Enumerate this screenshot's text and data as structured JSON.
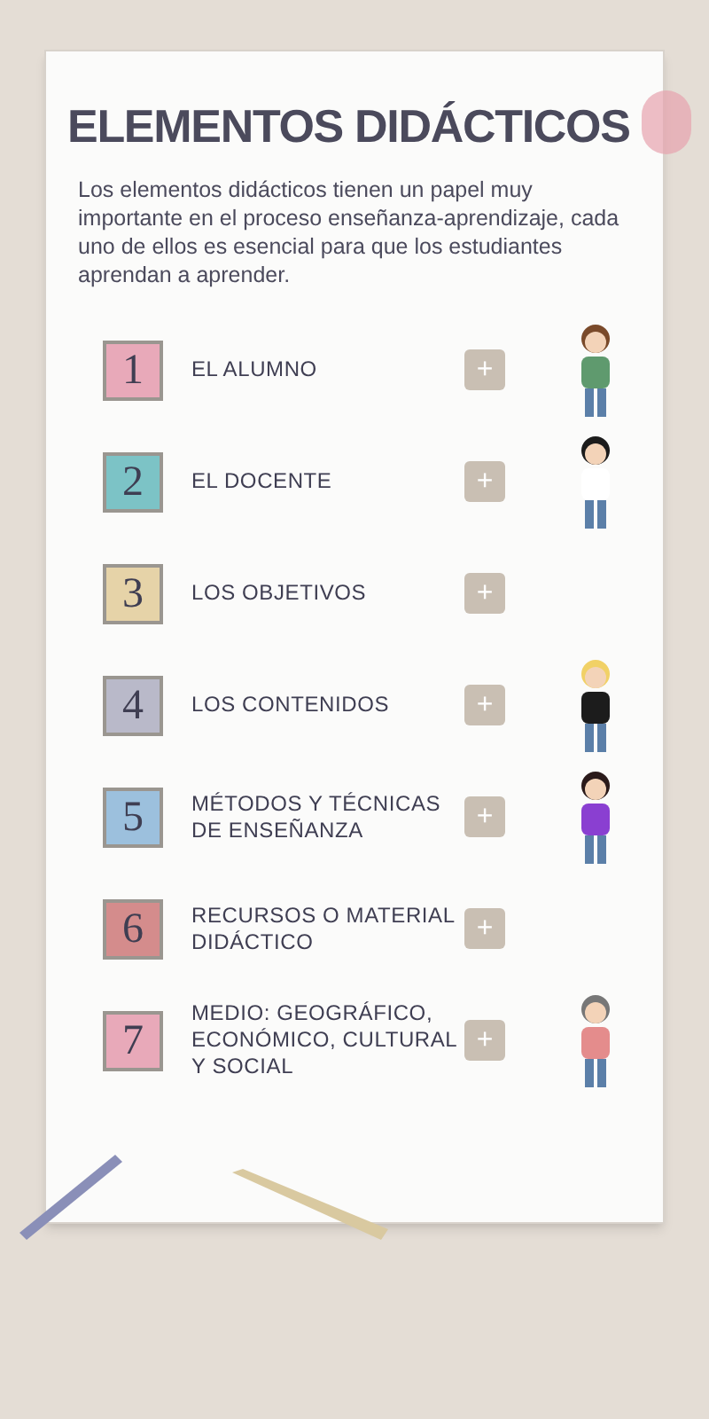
{
  "title": "ELEMENTOS DIDÁCTICOS",
  "intro": "Los elementos didácticos tienen un papel muy importante en el proceso enseñanza-aprendizaje, cada uno de ellos es esencial para que los estudiantes aprendan a aprender.",
  "items": [
    {
      "number": "1",
      "label": "EL ALUMNO",
      "color": "#e8a9b9",
      "button": "+"
    },
    {
      "number": "2",
      "label": "EL DOCENTE",
      "color": "#7cc3c6",
      "button": "+"
    },
    {
      "number": "3",
      "label": "LOS OBJETIVOS",
      "color": "#e6d3a8",
      "button": "+"
    },
    {
      "number": "4",
      "label": "LOS CONTENIDOS",
      "color": "#b9b9c9",
      "button": "+"
    },
    {
      "number": "5",
      "label": "MÉTODOS Y TÉCNICAS DE ENSEÑANZA",
      "color": "#9cc0dd",
      "button": "+"
    },
    {
      "number": "6",
      "label": "RECURSOS O MATERIAL DIDÁCTICO",
      "color": "#d48c8c",
      "button": "+"
    },
    {
      "number": "7",
      "label": "MEDIO: GEOGRÁFICO, ECONÓMICO, CULTURAL Y SOCIAL",
      "color": "#e8a9b9",
      "button": "+"
    }
  ]
}
